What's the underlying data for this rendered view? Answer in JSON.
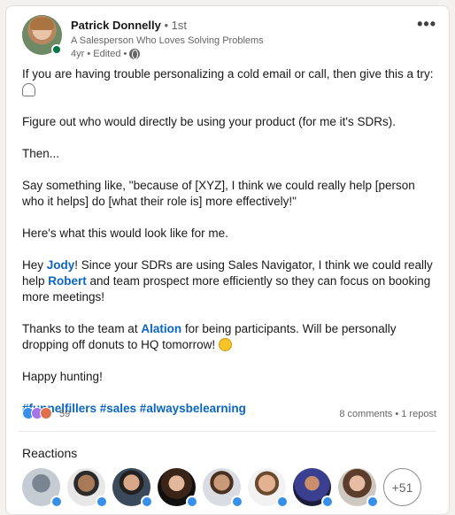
{
  "author": {
    "name": "Patrick Donnelly",
    "degree": " • 1st",
    "headline": "A Salesperson Who Loves Solving Problems",
    "meta": "4yr • Edited •"
  },
  "post": {
    "p1": "If you are having trouble personalizing a cold email or call, then give this a try:",
    "p2": "Figure out who would directly be using your product (for me it's SDRs).",
    "p3": "Then...",
    "p4": "Say something like, \"because of [XYZ], I think we could really help [person who it helps] do [what their role is] more effectively!\"",
    "p5": "Here's what this would look like for me.",
    "p6_a": "Hey ",
    "p6_link1": "Jody",
    "p6_b": "! Since your SDRs are using Sales Navigator, I think we could really help ",
    "p6_link2": "Robert",
    "p6_c": " and team prospect more efficiently so they can focus on booking more meetings!",
    "p7_a": "Thanks to the team at ",
    "p7_link": "Alation",
    "p7_b": " for being participants. Will be personally dropping off donuts to HQ tomorrow!",
    "p8": "Happy hunting!",
    "hashtags": "#funnelfillers #sales #alwaysbelearning"
  },
  "social": {
    "reaction_count": "59",
    "comments_reposts": "8 comments • 1 repost"
  },
  "reactions": {
    "title": "Reactions",
    "more_label": "+51"
  },
  "colors": {
    "link": "#0a66c2",
    "like": "#378fe9",
    "online": "#057642"
  },
  "icons": {
    "more": "ellipsis-icon",
    "visibility": "globe-icon"
  }
}
